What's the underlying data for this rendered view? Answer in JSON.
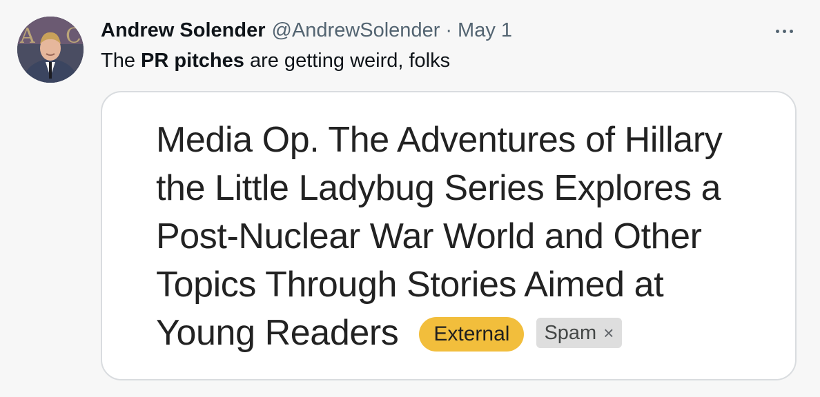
{
  "tweet": {
    "author_name": "Andrew Solender",
    "author_handle": "@AndrewSolender",
    "separator": "·",
    "timestamp": "May 1",
    "text_before": "The ",
    "text_bold": "PR pitches",
    "text_after": " are getting weird, folks",
    "more_icon": "more-horizontal-icon"
  },
  "media": {
    "subject_lines": [
      "Media Op. The Adventures of Hillary",
      "the Little Ladybug Series Explores a",
      "Post-Nuclear War World and Other",
      "Topics Through Stories Aimed at",
      "Young Readers"
    ],
    "label_external": "External",
    "label_spam": "Spam",
    "label_spam_close": "×",
    "label_external_color": "#f2be3c",
    "label_spam_color": "#dedede"
  },
  "colors": {
    "background": "#f7f7f7",
    "secondary_text": "#536471",
    "primary_text": "#0f1419"
  }
}
